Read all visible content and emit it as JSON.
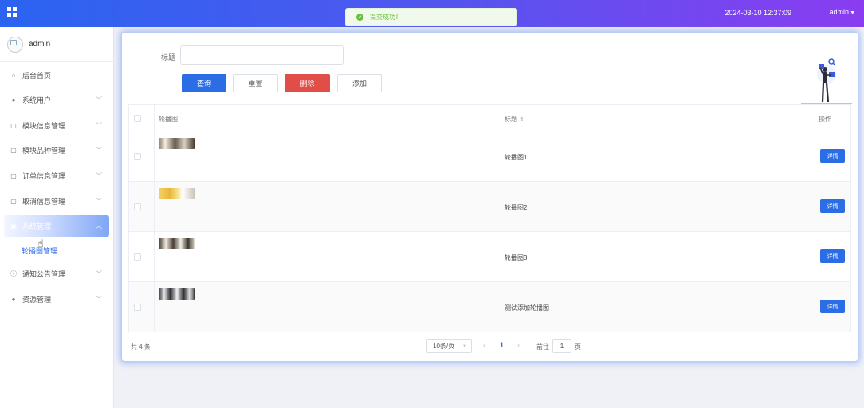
{
  "topbar": {
    "datetime": "2024-03-10 12:37:09",
    "user": "admin",
    "accent_start": "#2a64f1",
    "accent_end": "#8a3df0"
  },
  "toast": {
    "message": "提交成功！",
    "color": "#67c23a"
  },
  "sidebar": {
    "username": "admin",
    "items": [
      {
        "label": "后台首页",
        "icon": "home-icon",
        "glyph": "⌂"
      },
      {
        "label": "系统用户",
        "icon": "user-icon",
        "glyph": "●"
      },
      {
        "label": "模块信息管理",
        "icon": "document-icon",
        "glyph": "▢"
      },
      {
        "label": "模块品种管理",
        "icon": "document-icon",
        "glyph": "▢"
      },
      {
        "label": "订单信息管理",
        "icon": "document-icon",
        "glyph": "▢"
      },
      {
        "label": "取消信息管理",
        "icon": "document-icon",
        "glyph": "▢"
      },
      {
        "label": "系统管理",
        "icon": "image-icon",
        "glyph": "▣"
      },
      {
        "label": "通知公告管理",
        "icon": "info-icon",
        "glyph": "ⓘ"
      },
      {
        "label": "资源管理",
        "icon": "location-icon",
        "glyph": "●"
      }
    ],
    "sub_item": "轮播图管理"
  },
  "search": {
    "label": "标题",
    "value": "",
    "placeholder": ""
  },
  "buttons": {
    "query": "查询",
    "reset": "重置",
    "delete": "删除",
    "add": "添加"
  },
  "table": {
    "headers": {
      "image": "轮播图",
      "title": "标题",
      "actions": "操作"
    },
    "rows": [
      {
        "title": "轮播图1",
        "action": "详情",
        "thumb_color": "#6b5a48"
      },
      {
        "title": "轮播图2",
        "action": "详情",
        "thumb_color": "#e9c34a"
      },
      {
        "title": "轮播图3",
        "action": "详情",
        "thumb_color": "#3a3430"
      },
      {
        "title": "测试添加轮播图",
        "action": "详情",
        "thumb_color": "#2e2e32"
      }
    ]
  },
  "pagination": {
    "total": "共 4 条",
    "page_size": "10条/页",
    "current": "1",
    "goto_label": "前往",
    "goto_value": "1",
    "goto_unit": "页"
  }
}
